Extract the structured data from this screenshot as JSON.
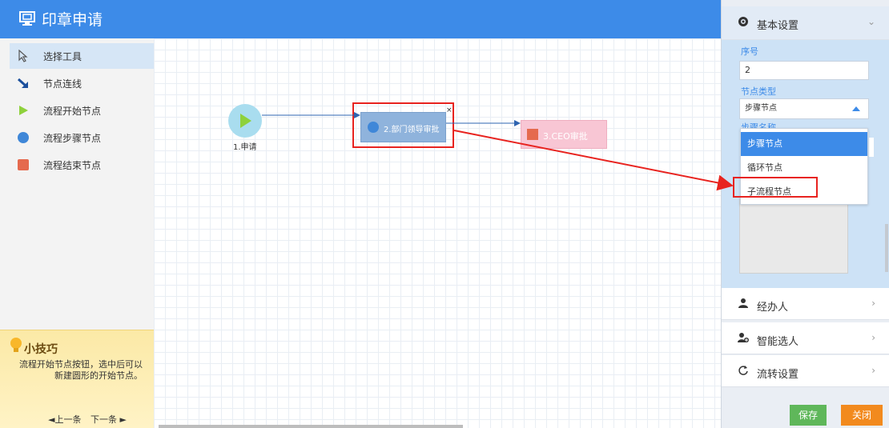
{
  "app": {
    "title": "印章申请"
  },
  "toolbox": {
    "items": [
      {
        "label": "选择工具",
        "icon": "pointer-icon"
      },
      {
        "label": "节点连线",
        "icon": "connector-arrow-icon"
      },
      {
        "label": "流程开始节点",
        "icon": "play-triangle-icon"
      },
      {
        "label": "流程步骤节点",
        "icon": "blue-circle-icon"
      },
      {
        "label": "流程结束节点",
        "icon": "red-square-icon"
      }
    ]
  },
  "tips": {
    "title": "小技巧",
    "text": "流程开始节点按钮，选中后可以新建圆形的开始节点。",
    "prev": "◄上一条",
    "next": "下一条 ►"
  },
  "canvas": {
    "nodes": [
      {
        "label": "1.申请"
      },
      {
        "label": "2.部门领导审批"
      },
      {
        "label": "3.CEO审批"
      }
    ],
    "close_glyph": "×"
  },
  "panel": {
    "sections": [
      {
        "title": "基本设置",
        "icon": "gear-icon"
      },
      {
        "title": "经办人",
        "icon": "user-icon"
      },
      {
        "title": "智能选人",
        "icon": "user-plus-icon"
      },
      {
        "title": "流转设置",
        "icon": "refresh-icon"
      }
    ],
    "fields": {
      "seq_label": "序号",
      "seq_value": "2",
      "type_label": "节点类型",
      "type_value": "步骤节点",
      "hidden_label": "步骤名称"
    },
    "dropdown_options": [
      "步骤节点",
      "循环节点",
      "子流程节点"
    ],
    "buttons": {
      "save": "保存",
      "close": "关闭"
    }
  },
  "colors": {
    "header": "#3d8be8",
    "highlight": "#e8231f",
    "save": "#5fb75a",
    "close": "#f28a1e"
  }
}
